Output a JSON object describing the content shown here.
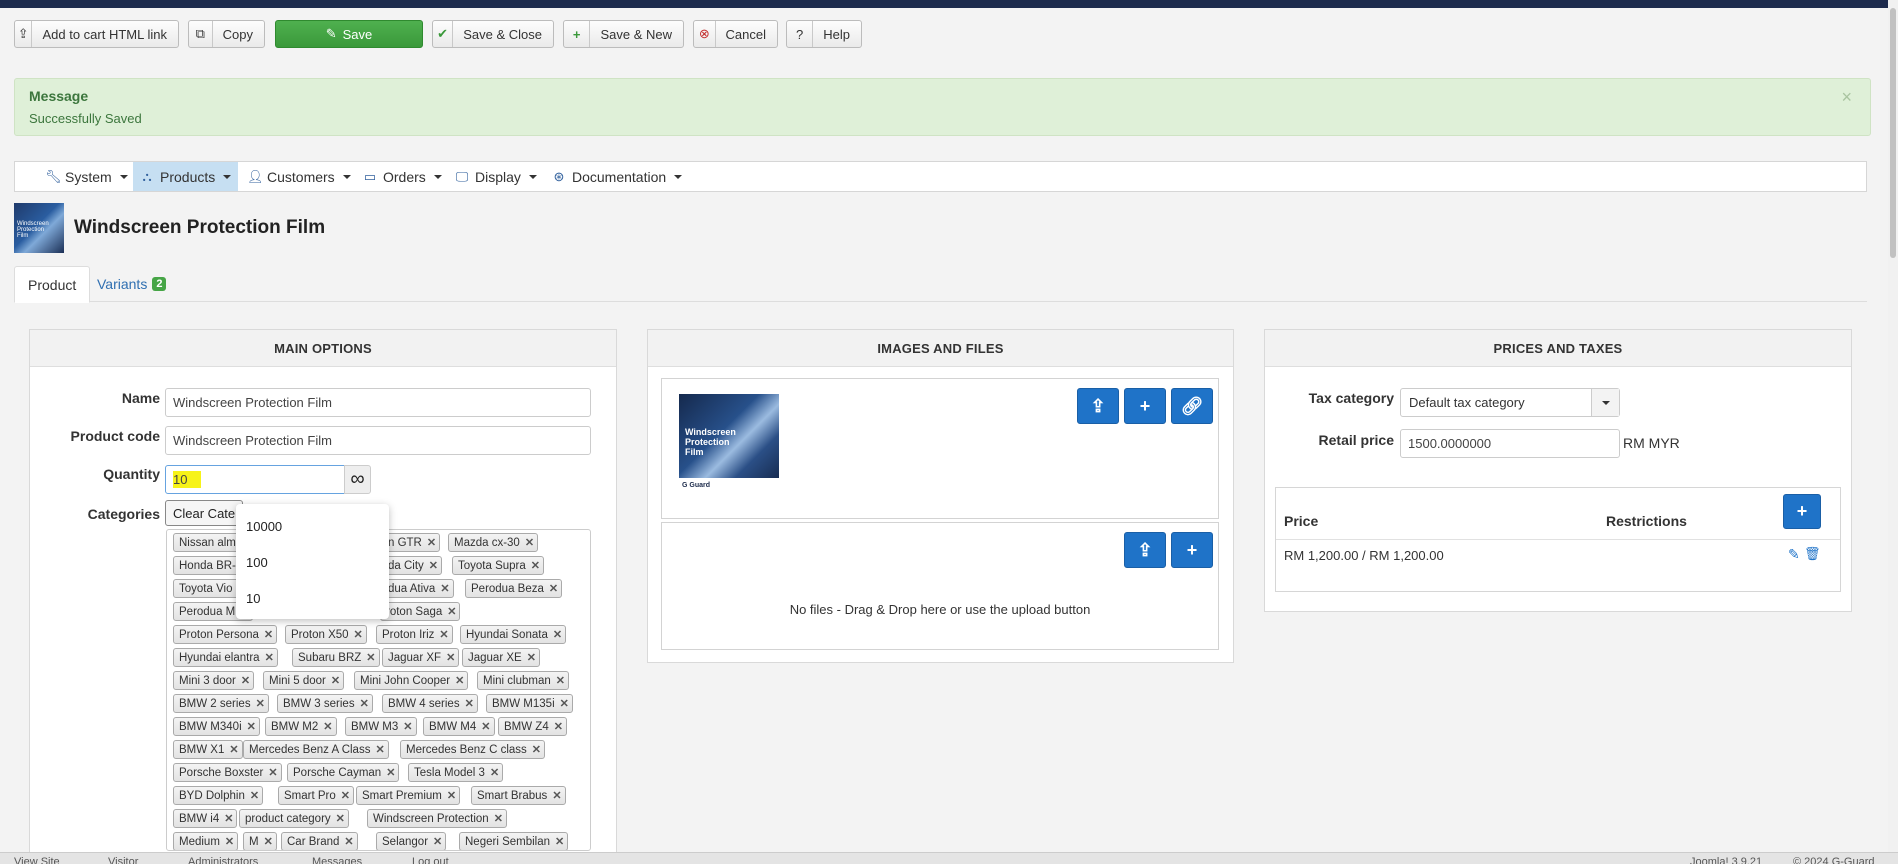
{
  "toolbar": {
    "add_to_cart": "Add to cart HTML link",
    "copy": "Copy",
    "save": "Save",
    "save_close": "Save & Close",
    "save_new": "Save & New",
    "cancel": "Cancel",
    "help": "Help"
  },
  "message": {
    "title": "Message",
    "text": "Successfully Saved",
    "close": "×"
  },
  "menu": {
    "items": [
      "System",
      "Products",
      "Customers",
      "Orders",
      "Display",
      "Documentation"
    ],
    "active": "Products"
  },
  "product": {
    "title": "Windscreen Protection Film",
    "thumb_text": "Windscreen Protection Film"
  },
  "tabs": {
    "product": "Product",
    "variants": "Variants",
    "variants_count": "2"
  },
  "main_options": {
    "heading": "MAIN OPTIONS",
    "name_label": "Name",
    "name_value": "Windscreen Protection Film",
    "code_label": "Product code",
    "code_value": "Windscreen Protection Film",
    "quantity_label": "Quantity",
    "quantity_value": "10",
    "infinity": "∞",
    "categories_label": "Categories",
    "clear_categories": "Clear Cate",
    "tags": [
      "Nissan alm",
      "n GTR",
      "Mazda cx-30",
      "Honda BR-",
      "da City",
      "Toyota Supra",
      "Toyota Vio",
      "dua Ativa",
      "Perodua Beza",
      "Perodua M",
      "roton Saga",
      "Proton Persona",
      "Proton X50",
      "Proton Iriz",
      "Hyundai Sonata",
      "Hyundai elantra",
      "Subaru BRZ",
      "Jaguar XF",
      "Jaguar XE",
      "Mini 3 door",
      "Mini 5 door",
      "Mini John Cooper",
      "Mini clubman",
      "BMW 2 series",
      "BMW 3 series",
      "BMW 4 series",
      "BMW M135i",
      "BMW M340i",
      "BMW M2",
      "BMW M3",
      "BMW M4",
      "BMW Z4",
      "BMW X1",
      "Mercedes Benz A Class",
      "Mercedes Benz C class",
      "Porsche Boxster",
      "Porsche Cayman",
      "Tesla Model 3",
      "BYD Dolphin",
      "Smart Pro",
      "Smart Premium",
      "Smart Brabus",
      "BMW i4",
      "product category",
      "Windscreen Protection",
      "Medium",
      "M",
      "Car Brand",
      "Selangor",
      "Negeri Sembilan"
    ],
    "dropdown": [
      "10000",
      "100",
      "10"
    ]
  },
  "images": {
    "heading": "IMAGES AND FILES",
    "thumb_line1": "Windscreen Protection Film",
    "thumb_brand": "G Guard",
    "no_files": "No files - Drag & Drop here or use the upload button"
  },
  "prices": {
    "heading": "PRICES AND TAXES",
    "tax_label": "Tax category",
    "tax_value": "Default tax category",
    "retail_label": "Retail price",
    "retail_value": "1500.0000000",
    "currency": "RM MYR",
    "col_price": "Price",
    "col_restrictions": "Restrictions",
    "row_price": "RM 1,200.00 / RM 1,200.00"
  },
  "footer": {
    "view_site": "View Site",
    "visitor": "Visitor",
    "administrators": "Administrators",
    "messages": "Messages",
    "logout": "Log out",
    "version": "Joomla! 3.9.21",
    "copyright": "© 2024 G-Guard"
  },
  "colors": {
    "accent": "#1f73c8",
    "save": "#3da53d",
    "message_bg": "#dff0d8",
    "highlight": "#f7f319"
  }
}
